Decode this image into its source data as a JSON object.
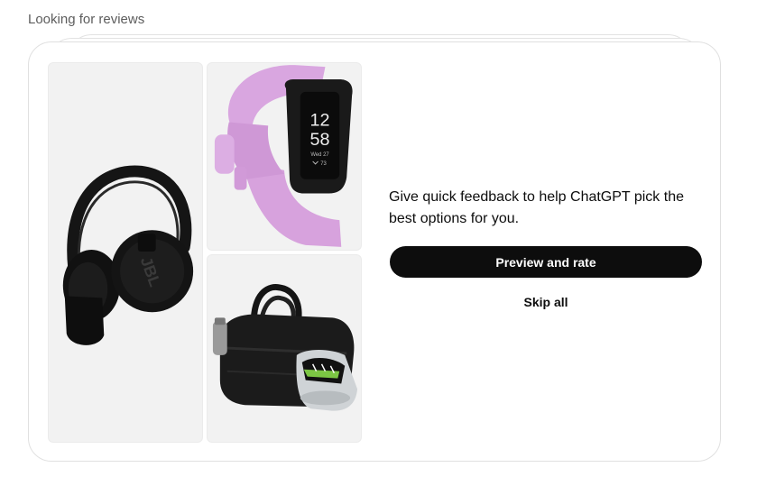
{
  "section": {
    "title": "Looking for reviews"
  },
  "products": [
    {
      "icon": "headphones-image",
      "brand_mark": "JBL"
    },
    {
      "icon": "fitness-tracker-image",
      "time_hours": "12",
      "time_minutes": "58",
      "date": "Wed 27",
      "stat": "73"
    },
    {
      "icon": "duffel-bag-image"
    }
  ],
  "feedback": {
    "prompt": "Give quick feedback to help ChatGPT pick the best options for you.",
    "preview_label": "Preview and rate",
    "skip_label": "Skip all"
  },
  "colors": {
    "button_bg": "#0d0d0d",
    "tile_bg": "#f2f2f2",
    "band_pink": "#d9a6e0"
  }
}
